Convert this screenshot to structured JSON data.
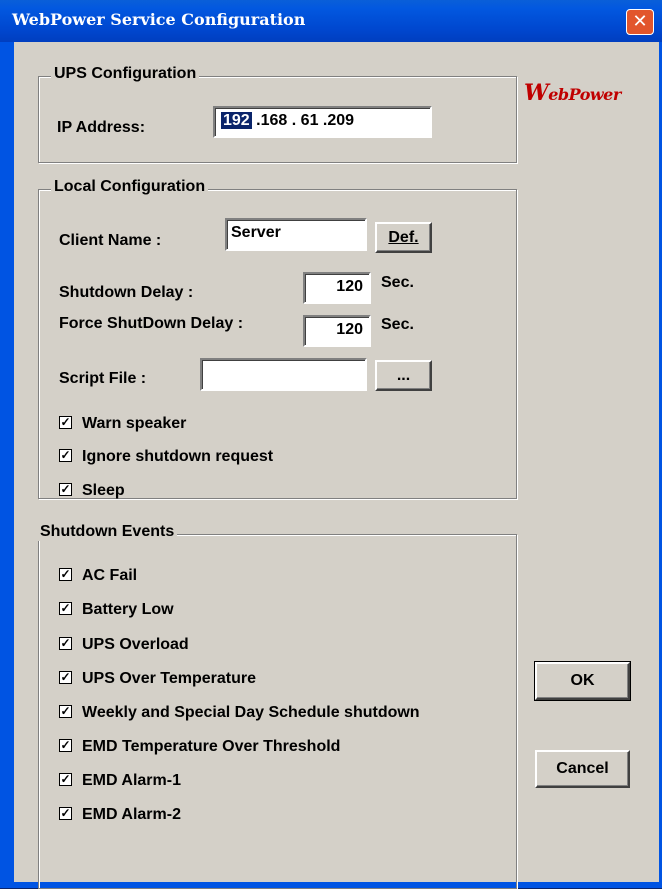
{
  "window": {
    "title": "WebPower Service Configuration",
    "close_icon": "close-icon"
  },
  "logo": {
    "first": "W",
    "rest": "ebPower"
  },
  "ups": {
    "group_title": "UPS Configuration",
    "ip_label": "IP Address:",
    "ip": {
      "o1": "192",
      "o2": "168",
      "o3": "61",
      "o4": "209",
      "sep": "."
    }
  },
  "local": {
    "group_title": "Local Configuration",
    "client_name_label": "Client Name :",
    "client_name_value": "Server",
    "def_button_label": "Def.",
    "shutdown_delay_label": "Shutdown Delay :",
    "shutdown_delay_value": "120",
    "sec_unit": "Sec.",
    "force_delay_label": "Force ShutDown Delay :",
    "force_delay_value": "120",
    "script_label": "Script File :",
    "script_value": "",
    "browse_button_label": "...",
    "checkboxes": [
      {
        "label": "Warn speaker",
        "checked": true
      },
      {
        "label": "Ignore shutdown request",
        "checked": true
      },
      {
        "label": "Sleep",
        "checked": true
      }
    ]
  },
  "events": {
    "group_title": "Shutdown Events",
    "items": [
      {
        "label": "AC Fail",
        "checked": true
      },
      {
        "label": "Battery Low",
        "checked": true
      },
      {
        "label": "UPS Overload",
        "checked": true
      },
      {
        "label": "UPS Over Temperature",
        "checked": true
      },
      {
        "label": "Weekly and Special Day Schedule shutdown",
        "checked": true
      },
      {
        "label": "EMD Temperature Over Threshold",
        "checked": true
      },
      {
        "label": "EMD Alarm-1",
        "checked": true
      },
      {
        "label": "EMD Alarm-2",
        "checked": true
      }
    ]
  },
  "buttons": {
    "ok": "OK",
    "cancel": "Cancel"
  }
}
